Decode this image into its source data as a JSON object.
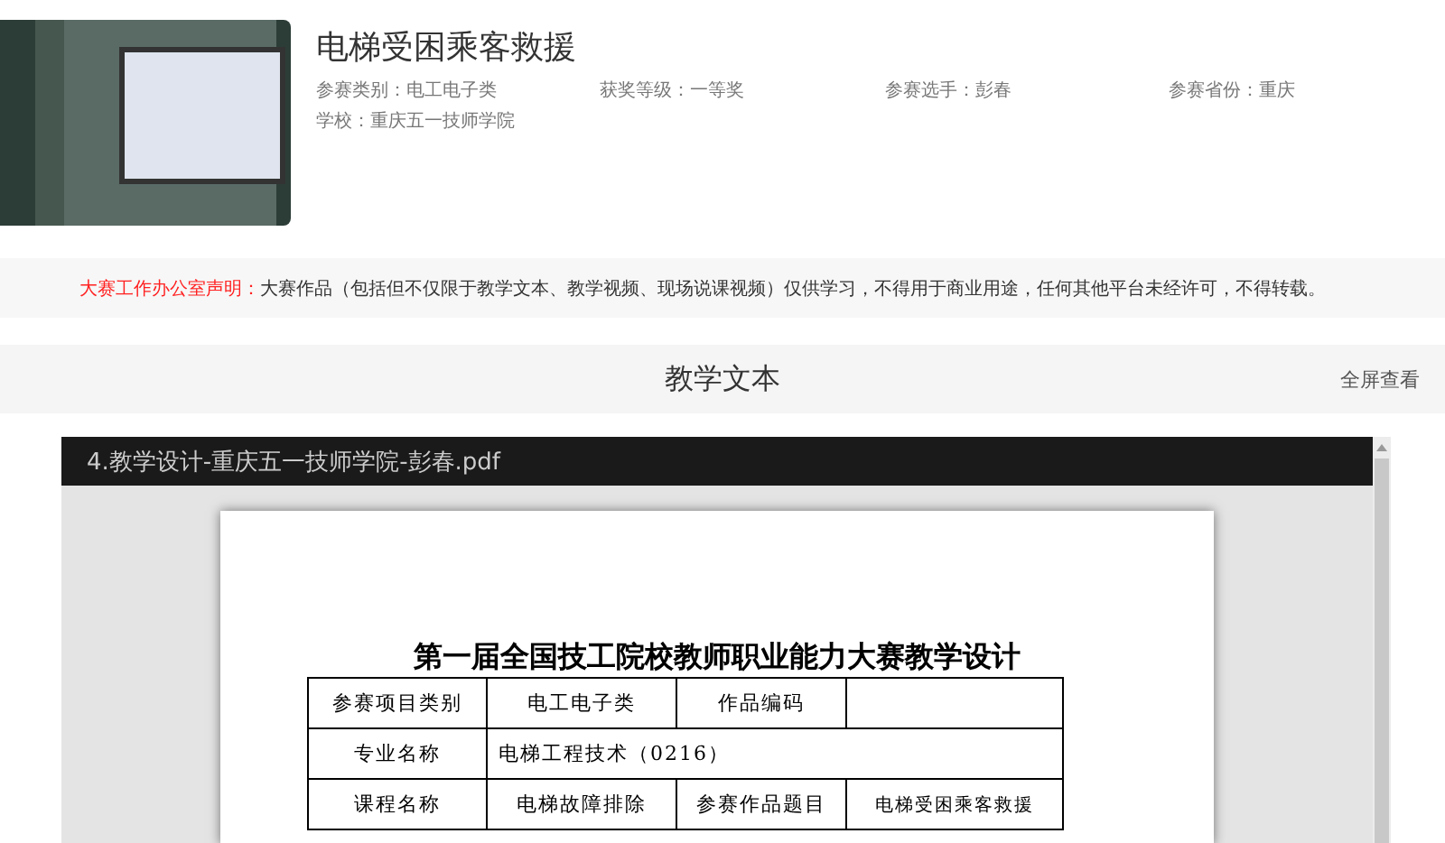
{
  "work": {
    "title": "电梯受困乘客救援",
    "meta": [
      {
        "label": "参赛类别：",
        "value": "电工电子类"
      },
      {
        "label": "获奖等级：",
        "value": "一等奖"
      },
      {
        "label": "参赛选手：",
        "value": "彭春"
      },
      {
        "label": "参赛省份：",
        "value": "重庆"
      }
    ],
    "school": {
      "label": "学校：",
      "value": "重庆五一技师学院"
    }
  },
  "notice": {
    "label": "大赛工作办公室声明：",
    "text": "大赛作品（包括但不仅限于教学文本、教学视频、现场说课视频）仅供学习，不得用于商业用途，任何其他平台未经许可，不得转载。"
  },
  "section": {
    "title": "教学文本",
    "action": "全屏查看"
  },
  "pdf": {
    "filename": "4.教学设计-重庆五一技师学院-彭春.pdf",
    "heading": "第一届全国技工院校教师职业能力大赛教学设计",
    "rows": [
      [
        {
          "text": "参赛项目类别"
        },
        {
          "text": "电工电子类"
        },
        {
          "text": "作品编码"
        },
        {
          "text": ""
        }
      ],
      [
        {
          "text": "专业名称"
        },
        {
          "text": "电梯工程技术（0216）",
          "colspan": 3
        }
      ],
      [
        {
          "text": "课程名称"
        },
        {
          "text": "电梯故障排除"
        },
        {
          "text": "参赛作品题目"
        },
        {
          "text": "电梯受困乘客救援"
        }
      ]
    ]
  }
}
